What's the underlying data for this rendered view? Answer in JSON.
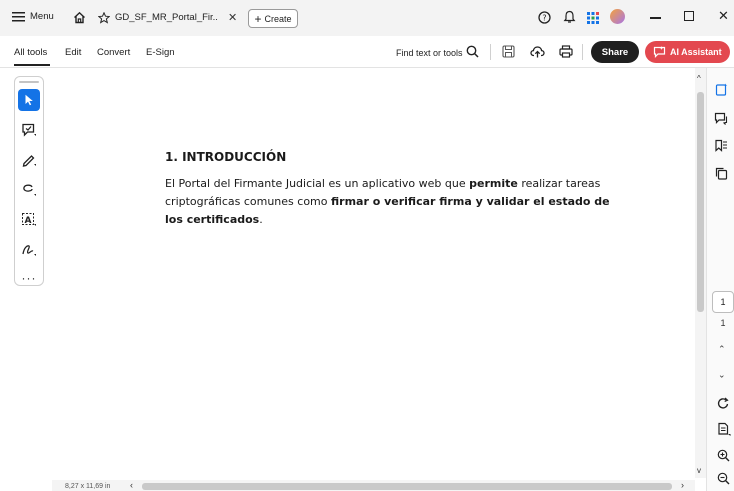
{
  "titlebar": {
    "menu_label": "Menu",
    "tab_title": "GD_SF_MR_Portal_Fir..",
    "create_label": "Create"
  },
  "toolbar": {
    "items": [
      "All tools",
      "Edit",
      "Convert",
      "E-Sign"
    ],
    "find_label": "Find text or tools",
    "share_label": "Share",
    "ai_label": "AI Assistant"
  },
  "document": {
    "heading": "1.  INTRODUCCIÓN",
    "para_1": "El Portal del Firmante Judicial es un aplicativo web que ",
    "para_bold_1": "permite",
    "para_2": " realizar tareas criptográficas comunes como ",
    "para_bold_2": "firmar o verificar firma y validar el estado de los certificados",
    "para_3": "."
  },
  "status": {
    "page_size": "8,27 x 11,69 in",
    "current_page": "1",
    "total_pages": "1"
  },
  "colors": {
    "ai_button": "#e3484f",
    "share_button": "#1f1f1f",
    "select_tool": "#1473e6"
  }
}
